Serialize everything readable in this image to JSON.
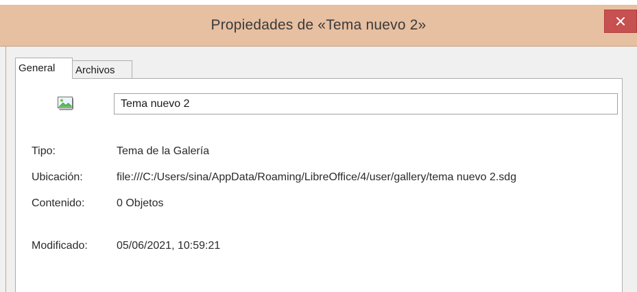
{
  "window": {
    "title": "Propiedades de «Tema nuevo 2»",
    "close_icon": "close-icon"
  },
  "tabs": [
    {
      "label": "General",
      "selected": true
    },
    {
      "label": "Archivos",
      "selected": false
    }
  ],
  "general": {
    "icon": "gallery-theme-icon",
    "name_value": "Tema nuevo 2",
    "fields": {
      "tipo": {
        "label": "Tipo:",
        "value": "Tema de la Galería"
      },
      "ubicacion": {
        "label": "Ubicación:",
        "value": "file:///C:/Users/sina/AppData/Roaming/LibreOffice/4/user/gallery/tema nuevo 2.sdg"
      },
      "contenido": {
        "label": "Contenido:",
        "value": "0 Objetos"
      },
      "modificado": {
        "label": "Modificado:",
        "value": "05/06/2021, 10:59:21"
      }
    }
  },
  "colors": {
    "titlebar": "#e7bfa1",
    "close_button": "#c75050",
    "dialog_background": "#f0f0f0"
  }
}
